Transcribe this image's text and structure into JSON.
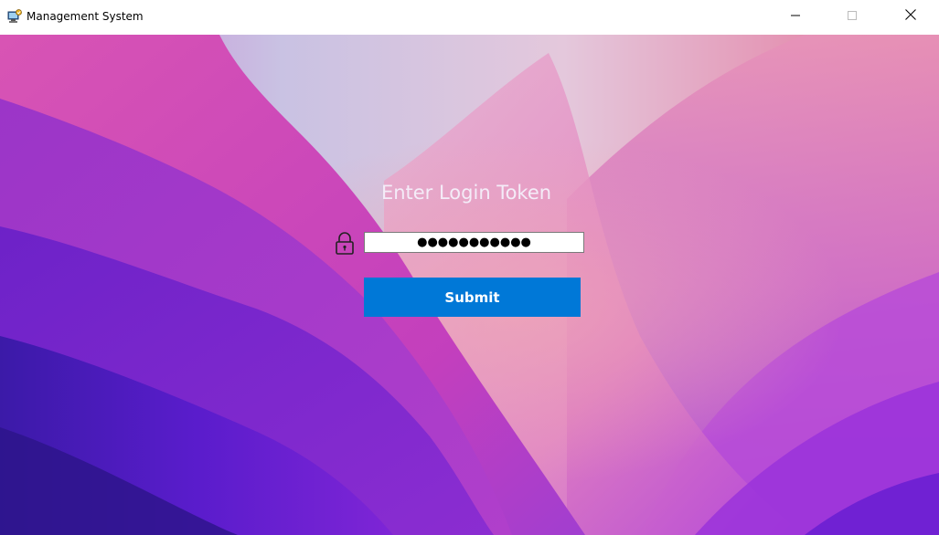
{
  "window": {
    "title": "Management System",
    "icon": "computer-app-icon",
    "controls": {
      "minimize": "minimize-icon",
      "maximize": "maximize-icon",
      "close": "close-icon"
    }
  },
  "login": {
    "heading": "Enter Login Token",
    "lock_icon": "lock-icon",
    "token_value": "●●●●●●●●●●●",
    "submit_label": "Submit"
  },
  "colors": {
    "accent": "#0078d7",
    "titlebar_bg": "#ffffff",
    "wallpaper_primary": "#8a2fd1",
    "wallpaper_secondary": "#e46fb5"
  }
}
